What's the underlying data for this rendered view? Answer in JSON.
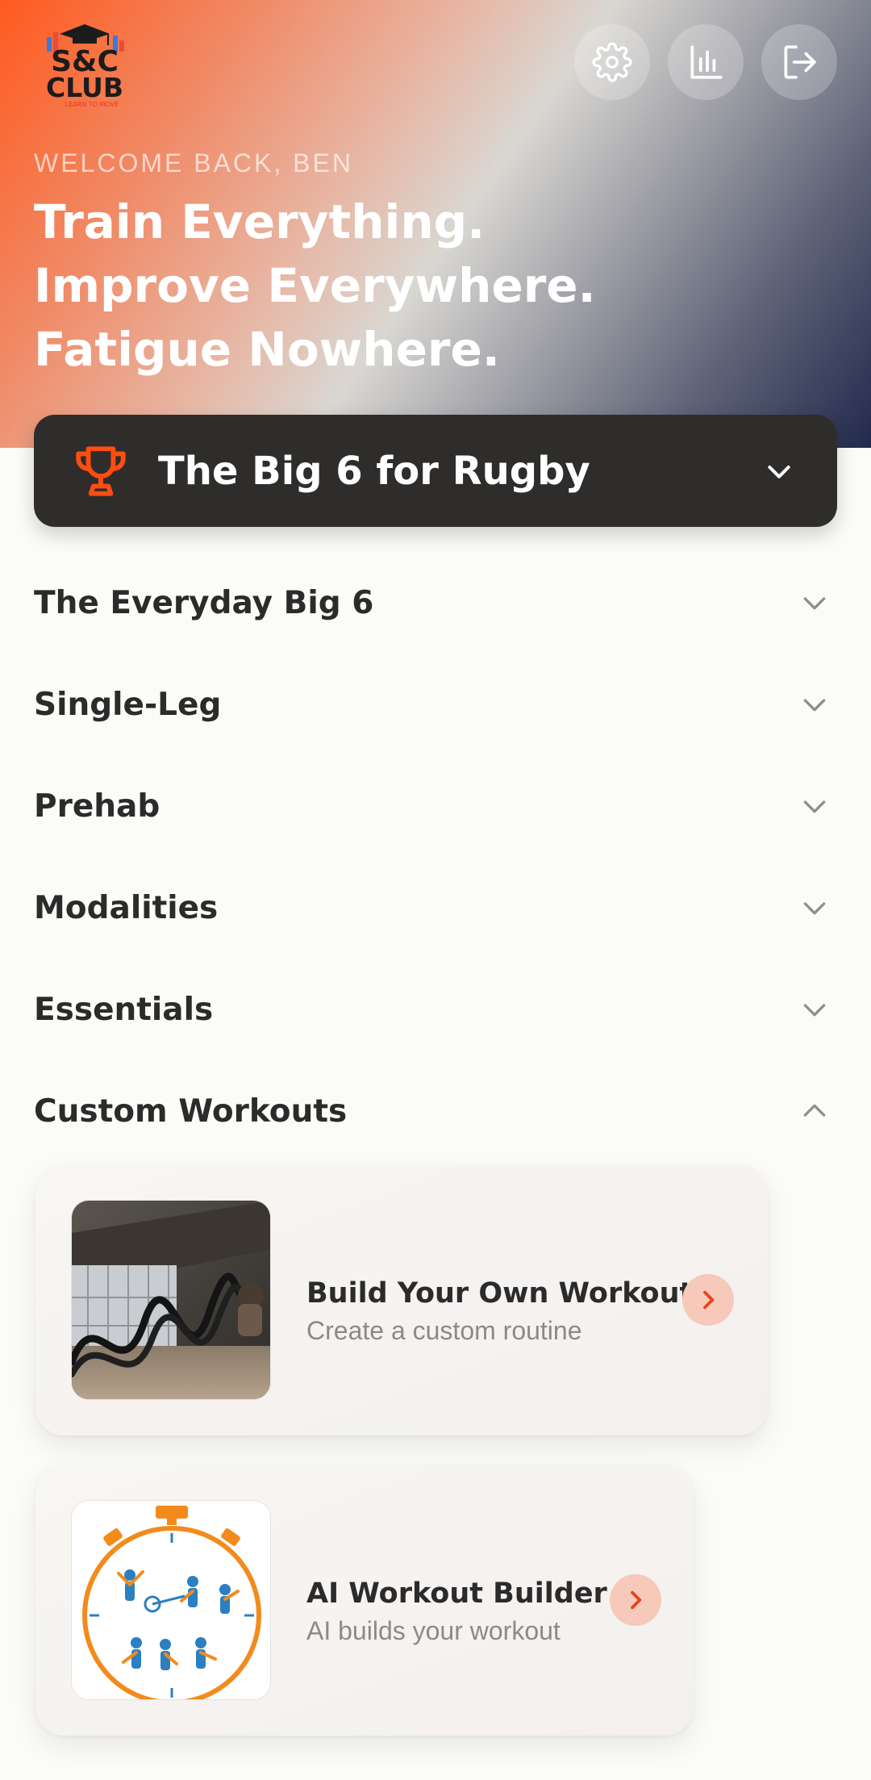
{
  "header": {
    "logo_text_line1": "S&C",
    "logo_text_line2": "CLUB",
    "logo_tagline": "LEARN TO MOVE",
    "welcome": "WELCOME BACK, BEN",
    "tagline": [
      "Train Everything.",
      "Improve Everywhere.",
      "Fatigue Nowhere."
    ],
    "actions": [
      {
        "icon": "gear-icon"
      },
      {
        "icon": "bar-chart-icon"
      },
      {
        "icon": "logout-icon"
      }
    ]
  },
  "program_selector": {
    "icon": "trophy-icon",
    "label": "The Big 6 for Rugby",
    "accent": "#ff4d12"
  },
  "sections": [
    {
      "label": "The Everyday Big 6",
      "expanded": false
    },
    {
      "label": "Single-Leg",
      "expanded": false
    },
    {
      "label": "Prehab",
      "expanded": false
    },
    {
      "label": "Modalities",
      "expanded": false
    },
    {
      "label": "Essentials",
      "expanded": false
    },
    {
      "label": "Custom Workouts",
      "expanded": true
    }
  ],
  "custom_workouts": [
    {
      "title": "Build Your Own Workout",
      "subtitle": "Create a custom routine",
      "image": "battle-ropes-photo"
    },
    {
      "title": "AI Workout Builder",
      "subtitle": "AI builds your workout",
      "image": "stopwatch-athletes-illustration"
    }
  ],
  "colors": {
    "accent": "#ff4d12",
    "card_arrow_bg": "#f7c9bb",
    "dark_bar": "#2e2d2b"
  }
}
